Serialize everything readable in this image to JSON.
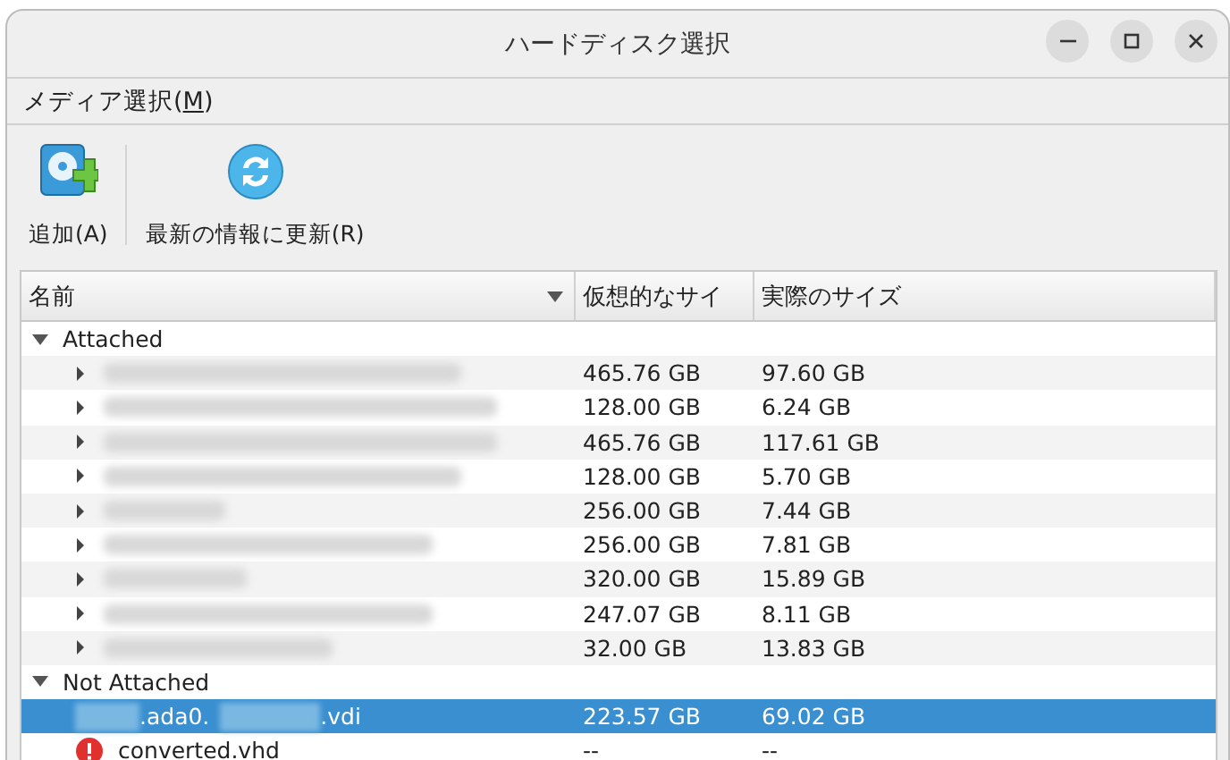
{
  "window": {
    "title": "ハードディスク選択"
  },
  "menu": [
    {
      "label": "メディア選択(",
      "mnemonic": "M",
      "tail": ")"
    }
  ],
  "toolbar": [
    {
      "kind": "add",
      "label": "追加(A)"
    },
    {
      "kind": "refresh",
      "label": "最新の情報に更新(R)"
    }
  ],
  "table": {
    "columns": [
      "名前",
      "仮想的なサイ",
      "実際のサイズ"
    ],
    "groups": [
      {
        "label": "Attached",
        "expanded": true,
        "items": [
          {
            "virtual": "465.76 GB",
            "actual": "97.60 GB",
            "expanded": false,
            "selected": false
          },
          {
            "virtual": "128.00 GB",
            "actual": "6.24 GB",
            "expanded": false,
            "selected": false
          },
          {
            "virtual": "465.76 GB",
            "actual": "117.61 GB",
            "expanded": false,
            "selected": false
          },
          {
            "virtual": "128.00 GB",
            "actual": "5.70 GB",
            "expanded": false,
            "selected": false
          },
          {
            "virtual": "256.00 GB",
            "actual": "7.44 GB",
            "expanded": false,
            "selected": false
          },
          {
            "virtual": "256.00 GB",
            "actual": "7.81 GB",
            "expanded": false,
            "selected": false
          },
          {
            "virtual": "320.00 GB",
            "actual": "15.89 GB",
            "expanded": false,
            "selected": false
          },
          {
            "virtual": "247.07 GB",
            "actual": "8.11 GB",
            "expanded": false,
            "selected": false
          },
          {
            "virtual": "32.00 GB",
            "actual": "13.83 GB",
            "expanded": false,
            "selected": false
          }
        ]
      },
      {
        "label": "Not Attached",
        "expanded": true,
        "items": [
          {
            "kind": "disk",
            "name_parts": [
              ".ada0.",
              ".vdi"
            ],
            "virtual": "223.57 GB",
            "actual": "69.02 GB",
            "selected": true
          },
          {
            "kind": "error",
            "name_parts": [
              "converted.vhd"
            ],
            "virtual": "--",
            "actual": "--",
            "selected": false
          }
        ]
      }
    ]
  }
}
